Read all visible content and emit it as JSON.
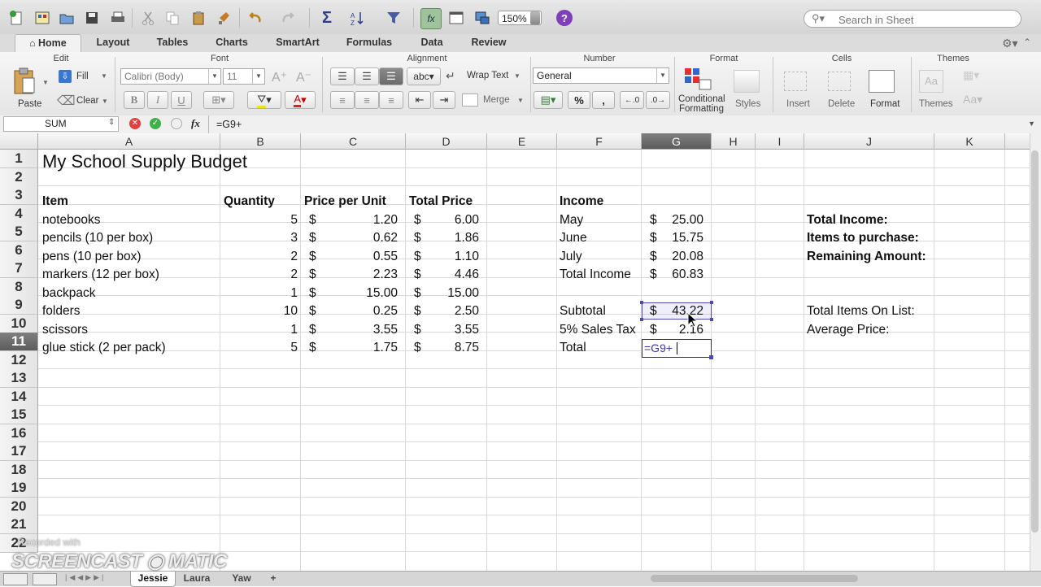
{
  "toolbar": {
    "zoom": "150%",
    "search_placeholder": "Search in Sheet"
  },
  "tabs": [
    "Home",
    "Layout",
    "Tables",
    "Charts",
    "SmartArt",
    "Formulas",
    "Data",
    "Review"
  ],
  "ribbon": {
    "groups": {
      "edit": "Edit",
      "font": "Font",
      "alignment": "Alignment",
      "number": "Number",
      "format": "Format",
      "cells": "Cells",
      "themes": "Themes"
    },
    "paste": "Paste",
    "fill": "Fill",
    "clear": "Clear",
    "font_name": "Calibri (Body)",
    "font_size": "11",
    "wrap_text": "Wrap Text",
    "merge": "Merge",
    "number_format": "General",
    "abc": "abc",
    "conditional_formatting_1": "Conditional",
    "conditional_formatting_2": "Formatting",
    "styles": "Styles",
    "insert": "Insert",
    "delete": "Delete",
    "format": "Format",
    "themes": "Themes"
  },
  "formula_bar": {
    "name_box": "SUM",
    "fx": "fx",
    "formula": "=G9+"
  },
  "columns": [
    "A",
    "B",
    "C",
    "D",
    "E",
    "F",
    "G",
    "H",
    "I",
    "J",
    "K"
  ],
  "rows": [
    "1",
    "2",
    "3",
    "4",
    "5",
    "6",
    "7",
    "8",
    "9",
    "10",
    "11",
    "12",
    "13",
    "14",
    "15",
    "16",
    "17",
    "18",
    "19",
    "20",
    "21",
    "22"
  ],
  "sheet": {
    "title": "My School Supply Budget",
    "headers": {
      "item": "Item",
      "quantity": "Quantity",
      "price_per_unit": "Price per Unit",
      "total_price": "Total Price",
      "income": "Income"
    },
    "items": [
      {
        "name": "notebooks",
        "qty": "5",
        "price": "1.20",
        "total": "6.00"
      },
      {
        "name": "pencils (10 per box)",
        "qty": "3",
        "price": "0.62",
        "total": "1.86"
      },
      {
        "name": "pens (10 per box)",
        "qty": "2",
        "price": "0.55",
        "total": "1.10"
      },
      {
        "name": "markers (12 per box)",
        "qty": "2",
        "price": "2.23",
        "total": "4.46"
      },
      {
        "name": "backpack",
        "qty": "1",
        "price": "15.00",
        "total": "15.00"
      },
      {
        "name": "folders",
        "qty": "10",
        "price": "0.25",
        "total": "2.50"
      },
      {
        "name": "scissors",
        "qty": "1",
        "price": "3.55",
        "total": "3.55"
      },
      {
        "name": "glue stick (2 per pack)",
        "qty": "5",
        "price": "1.75",
        "total": "8.75"
      }
    ],
    "currency": "$",
    "income_rows": [
      {
        "label": "May",
        "value": "25.00"
      },
      {
        "label": "June",
        "value": "15.75"
      },
      {
        "label": "July",
        "value": "20.08"
      },
      {
        "label": "Total Income",
        "value": "60.83"
      }
    ],
    "subtotal": {
      "label": "Subtotal",
      "value": "43.22"
    },
    "sales_tax": {
      "label": "5% Sales Tax",
      "value": "2.16"
    },
    "total": {
      "label": "Total",
      "value": "=G9+"
    },
    "summary": {
      "total_income": "Total Income:",
      "items_to_purchase": "Items to purchase:",
      "remaining_amount": "Remaining Amount:",
      "total_items_on_list": "Total Items On List:",
      "average_price": "Average Price:"
    }
  },
  "sheet_tabs": [
    "Jessie",
    "Laura",
    "Yaw",
    "+"
  ],
  "watermark": {
    "small": "Recorded with",
    "big": "SCREENCAST ◉ MATIC"
  }
}
